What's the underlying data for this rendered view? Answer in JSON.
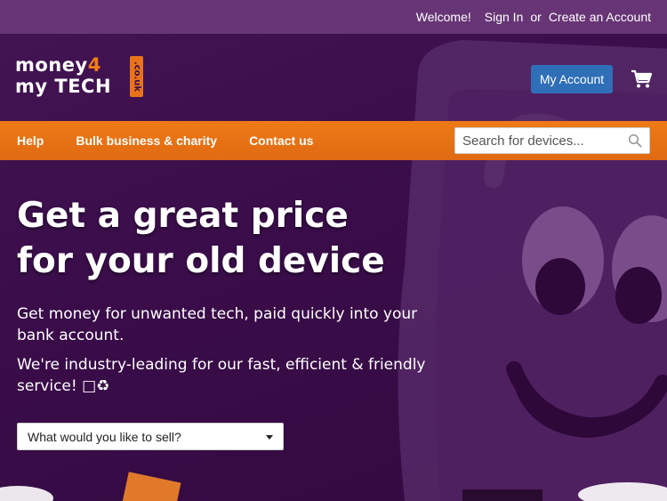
{
  "topbar": {
    "welcome": "Welcome!",
    "sign_in": "Sign In",
    "or": "or",
    "create_account": "Create an Account"
  },
  "logo": {
    "line1_a": "money",
    "line1_b": "4",
    "line2": "my TECH",
    "domain": ".co.uk"
  },
  "header": {
    "account_button": "My Account",
    "cart_icon": "shopping-cart-icon"
  },
  "nav": {
    "items": [
      "Help",
      "Bulk business & charity",
      "Contact us"
    ]
  },
  "search": {
    "placeholder": "Search for devices...",
    "icon": "search-icon"
  },
  "hero": {
    "title_line1": "Get a great price",
    "title_line2": "for your old device",
    "paragraph1": "Get money for unwanted tech, paid quickly into your bank account.",
    "paragraph2": "We're industry-leading for our fast, efficient & friendly service! □♻",
    "select_value": "What would you like to sell?"
  },
  "colors": {
    "background": "#3b0e4c",
    "topbar": "#6e3c7d",
    "nav_orange": "#e8731a",
    "account_button": "#2f6fb8"
  }
}
